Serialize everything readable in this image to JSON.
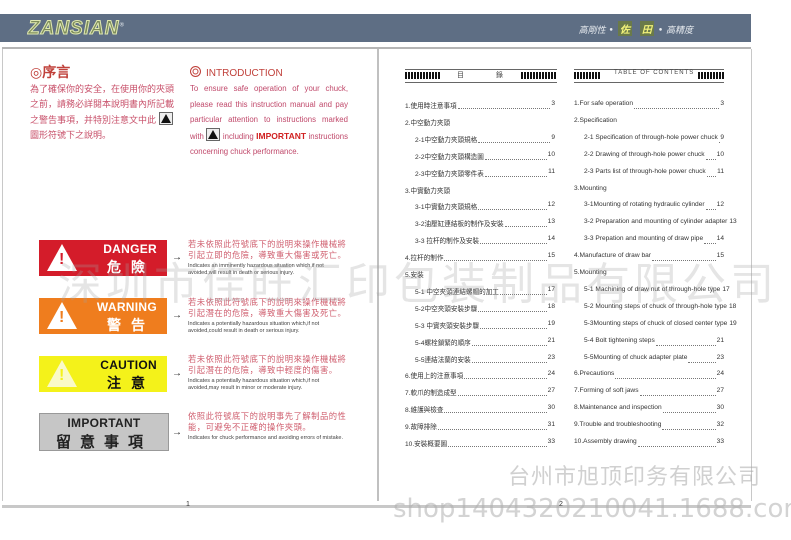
{
  "header": {
    "logo": "ZANSIAN",
    "logo_mark": "®",
    "slogan_left": "高剛性 •",
    "slogan_hl1": "佐",
    "slogan_hl2": "田",
    "slogan_right": "• 高精度",
    "band_color": "#5e6e84"
  },
  "left_page": {
    "preface_title": "◎序言",
    "preface_body_1": "為了確保你的安全，在使用你的夾頭之前，請務必詳閱本說明書內所記載之警告事項，并特別注意文中此",
    "preface_body_2": "圖形符號下之說明。",
    "intro_title": "INTRODUCTION",
    "intro_body_1": "To ensure safe operation of your chuck, please read this instruction manual and pay particular attention to instructions marked with",
    "intro_body_2": "including",
    "intro_important": "IMPORTANT",
    "intro_body_3": "instructions concerning chuck performance.",
    "signs": [
      {
        "en": "DANGER",
        "cn": "危險",
        "zh": "若未依照此符號底下的說明來操作機械將引起立即的危險，導致重大傷害或死亡。",
        "desc": "Indicates an imminently hazardous situation which,if not avoided,will result in death or serious injury.",
        "color": "#d41c2a"
      },
      {
        "en": "WARNING",
        "cn": "警告",
        "zh": "若未依照此符號底下的說明來操作機械將引起潛在的危險，導致重大傷害及死亡。",
        "desc": "Indicates a potentially hazardous situation which,if not avoided,could result in death or serious injury.",
        "color": "#ef7d1e"
      },
      {
        "en": "CAUTION",
        "cn": "注意",
        "zh": "若未依照此符號底下的說明來操作機械將引起潛在的危險，導致中輕度的傷害。",
        "desc": "Indicates a potentially hazardous situation which,if not avoided,may result in minor or moderate injury.",
        "color": "#f4f21a"
      },
      {
        "en": "IMPORTANT",
        "cn": "留意事項",
        "zh": "依照此符號底下的說明事先了解制品的性能，可避免不正確的操作夾頭。",
        "desc": "Indicates for chuck performance and avoiding errors of mistake.",
        "color": "#c6c6c6"
      }
    ],
    "arrow": "→",
    "page_number": "1"
  },
  "right_page": {
    "toc_cn_title": "目　　錄",
    "toc_en_title": "TABLE  OF CONTENTS",
    "toc_cn": [
      {
        "t": "1.使用時注意事項",
        "p": "3",
        "indent": 0
      },
      {
        "t": "2.中空動力夾頭",
        "p": "",
        "indent": 0
      },
      {
        "t": "2-1中空動力夾頭規格",
        "p": "9",
        "indent": 1
      },
      {
        "t": "2-2中空動力夾頭構造圖",
        "p": "10",
        "indent": 1
      },
      {
        "t": "2-3中空動力夾頭零件表",
        "p": "11",
        "indent": 1
      },
      {
        "t": "3.中實動力夾頭",
        "p": "",
        "indent": 0
      },
      {
        "t": "3-1中實動力夾頭規格",
        "p": "12",
        "indent": 1
      },
      {
        "t": "3-2油壓缸連結板的制作及安裝",
        "p": "13",
        "indent": 1
      },
      {
        "t": "3-3 拉杆的制作及安裝",
        "p": "14",
        "indent": 1
      },
      {
        "t": "4.拉杆的制作",
        "p": "15",
        "indent": 0
      },
      {
        "t": "5.安裝",
        "p": "",
        "indent": 0
      },
      {
        "t": "5-1 中空夾頭連結螺帽的加工",
        "p": "17",
        "indent": 1
      },
      {
        "t": "5-2中空夾頭安裝步驟",
        "p": "18",
        "indent": 1
      },
      {
        "t": "5-3 中實夾頭安裝步驟",
        "p": "19",
        "indent": 1
      },
      {
        "t": "5-4螺栓鎖緊的順序",
        "p": "21",
        "indent": 1
      },
      {
        "t": "5-5連結法蘭的安裝",
        "p": "23",
        "indent": 1
      },
      {
        "t": "6.使用上的注意事項",
        "p": "24",
        "indent": 0
      },
      {
        "t": "7.軟爪的制造成型",
        "p": "27",
        "indent": 0
      },
      {
        "t": "8.維護與檢查",
        "p": "30",
        "indent": 0
      },
      {
        "t": "9.故障排除",
        "p": "31",
        "indent": 0
      },
      {
        "t": "10.安裝概要圖",
        "p": "33",
        "indent": 0
      }
    ],
    "toc_en": [
      {
        "t": "1.For safe operation",
        "p": "3",
        "indent": 0
      },
      {
        "t": "2.Specification",
        "p": "",
        "indent": 0
      },
      {
        "t": "2-1 Specification of through-hole power chuck",
        "p": "9",
        "indent": 1
      },
      {
        "t": "2-2 Drawing of through-hole power chuck",
        "p": "10",
        "indent": 1
      },
      {
        "t": "2-3 Parts list of through-hole power chuck",
        "p": "11",
        "indent": 1
      },
      {
        "t": "3.Mounting",
        "p": "",
        "indent": 0
      },
      {
        "t": "3-1Mounting of rotating hydraulic cylinder",
        "p": "12",
        "indent": 1
      },
      {
        "t": "3-2 Preparation and mounting of cylinder adapter",
        "p": "13",
        "indent": 1
      },
      {
        "t": "3-3 Prepation and mounting of draw pipe",
        "p": "14",
        "indent": 1
      },
      {
        "t": "4.Manufacture of draw bar",
        "p": "15",
        "indent": 0
      },
      {
        "t": "5.Mounting",
        "p": "",
        "indent": 0
      },
      {
        "t": "5-1 Machining of draw nut of through-hole type",
        "p": "17",
        "indent": 1
      },
      {
        "t": "5-2 Mounting steps of chuck of through-hole type",
        "p": "18",
        "indent": 1
      },
      {
        "t": "5-3Mounting steps of chuck of closed center type",
        "p": "19",
        "indent": 1
      },
      {
        "t": "5-4 Bolt tightening steps",
        "p": "21",
        "indent": 1
      },
      {
        "t": "5-5Mounting of chuck adapter plate",
        "p": "23",
        "indent": 1
      },
      {
        "t": "6.Precautions",
        "p": "24",
        "indent": 0
      },
      {
        "t": "7.Forming of soft jaws",
        "p": "27",
        "indent": 0
      },
      {
        "t": "8.Maintenance and inspection",
        "p": "30",
        "indent": 0
      },
      {
        "t": "9.Trouble and troubleshooting",
        "p": "32",
        "indent": 0
      },
      {
        "t": "10.Assembly drawing",
        "p": "33",
        "indent": 0
      }
    ],
    "page_number": "2"
  },
  "watermarks": {
    "center": "深圳市佳旺汇印包装制品有限公司",
    "bottom_right_cn": "台州市旭顶印务有限公司",
    "bottom_url": "shop1404320210041.1688.com"
  }
}
